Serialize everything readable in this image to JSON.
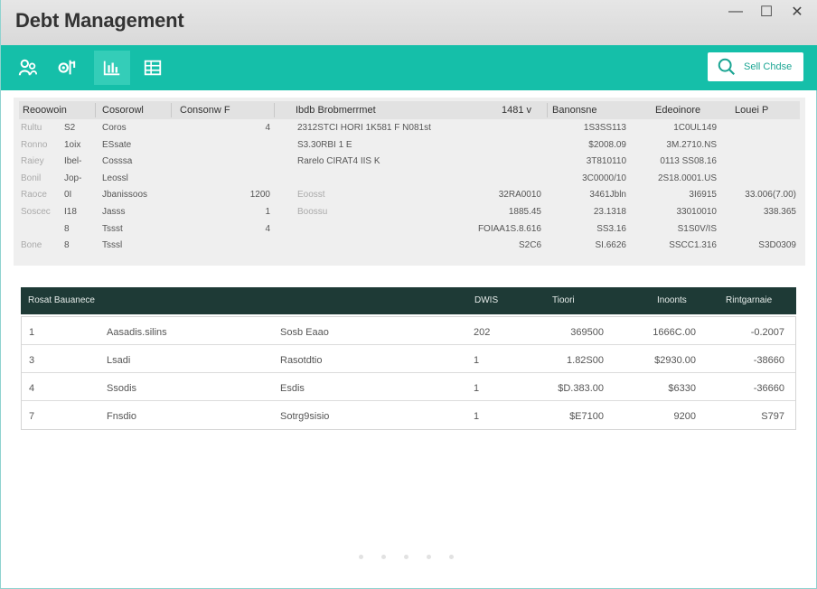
{
  "window": {
    "title": "Debt Management",
    "controls": [
      "—",
      "☐",
      "✕"
    ]
  },
  "toolbar": {
    "search_label": "Sell Chdse",
    "tools": [
      "people-icon",
      "settings-icon",
      "chart-icon",
      "grid-icon"
    ],
    "accent": "#15bfa9"
  },
  "summary": {
    "headers": [
      "Reoowoin",
      "Cosorowl",
      "Consonw F",
      "Ibdb Brobmerrmet",
      "1481 v",
      "Banonsne",
      "Edeoinore",
      "Louei P"
    ],
    "rows": [
      [
        "Rultu",
        "S2",
        "Coros",
        "4",
        "2312STCI HORI 1K581 F N081st",
        "",
        "1S3SS113",
        "1C0UL149",
        ""
      ],
      [
        "Ronno",
        "1oix",
        "ESsate",
        "",
        "S3.30RBI 1 E",
        "",
        "$2008.09",
        "3M.2710.NS",
        ""
      ],
      [
        "Raiey",
        "Ibel-",
        "Cosssa",
        "",
        "Rarelo CIRAT4 IIS K",
        "",
        "3T810110",
        "0113 SS08.16",
        ""
      ],
      [
        "Bonil",
        "Jop-",
        "Leossl",
        "",
        "",
        "",
        "3C0000/10",
        "2S18.0001.US",
        ""
      ],
      [
        "Raoce",
        "0I",
        "Jbanissoos",
        "1200",
        "Eoosst",
        "32RA0010",
        "3461Jbln",
        "3I6915",
        "33.006(7.00)"
      ],
      [
        "Soscec",
        "I18",
        "Jasss",
        "1",
        "Boossu",
        "1885.45",
        "23.1318",
        "33010010",
        "338.365"
      ],
      [
        "",
        "8",
        "Tssst",
        "4",
        "",
        "FOIAA1S.8.616",
        "SS3.16",
        "S1S0V/IS",
        ""
      ],
      [
        "Bone",
        "8",
        "Tsssl",
        "",
        "",
        "S2C6",
        "SI.6626",
        "SSCC1.316",
        "S3D0309"
      ]
    ]
  },
  "details": {
    "headers": [
      "Rosat Bauanece",
      "DWIS",
      "Tioori",
      "Inoonts",
      "Rintgarnaie"
    ],
    "rows": [
      [
        "1",
        "Aasadis.silins",
        "Sosb Eaao",
        "202",
        "369500",
        "1666C.00",
        "-0.2007"
      ],
      [
        "3",
        "Lsadi",
        "Rasotdtio",
        "1",
        "1.82S00",
        "$2930.00",
        "-38660"
      ],
      [
        "4",
        "Ssodis",
        "Esdis",
        "1",
        "$D.383.00",
        "$6330",
        "-36660"
      ],
      [
        "7",
        "Fnsdio",
        "Sotrg9sisio",
        "1",
        "$E7100",
        "9200",
        "S797"
      ]
    ]
  }
}
